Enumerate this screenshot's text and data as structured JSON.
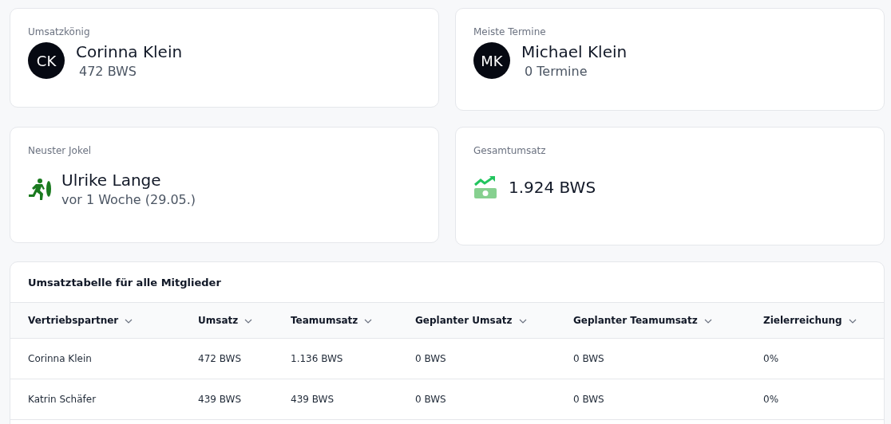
{
  "cards": [
    {
      "kind": "avatar",
      "label": "Umsatzkönig",
      "initials": "CK",
      "name": "Corinna Klein",
      "detail": "472 BWS"
    },
    {
      "kind": "avatar",
      "label": "Meiste Termine",
      "initials": "MK",
      "name": "Michael Klein",
      "detail": "0 Termine"
    },
    {
      "kind": "runner",
      "label": "Neuster Jokel",
      "name": "Ulrike Lange",
      "detail": "vor 1 Woche (29.05.)"
    },
    {
      "kind": "money",
      "label": "Gesamtumsatz",
      "name": "1.924 BWS"
    }
  ],
  "table": {
    "title": "Umsatztabelle für alle Mitglieder",
    "columns": [
      "Vertriebspartner",
      "Umsatz",
      "Teamumsatz",
      "Geplanter Umsatz",
      "Geplanter Teamumsatz",
      "Zielerreichung"
    ],
    "rows": [
      [
        "Corinna Klein",
        "472 BWS",
        "1.136 BWS",
        "0 BWS",
        "0 BWS",
        "0%"
      ],
      [
        "Katrin Schäfer",
        "439 BWS",
        "439 BWS",
        "0 BWS",
        "0 BWS",
        "0%"
      ]
    ]
  }
}
